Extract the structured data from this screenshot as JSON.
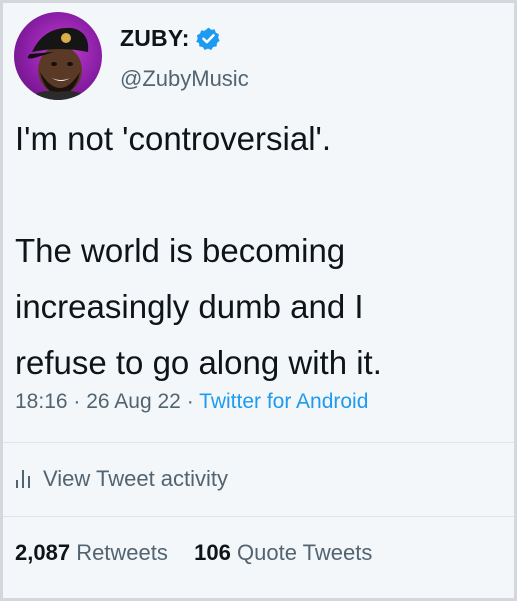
{
  "tweet": {
    "display_name": "ZUBY:",
    "handle": "@ZubyMusic",
    "text_lines": [
      "I'm not 'controversial'.",
      "",
      "The world is becoming",
      "increasingly dumb and I",
      "refuse to go along with it."
    ],
    "time": "18:16",
    "date": "26 Aug 22",
    "source": "Twitter for Android",
    "separator": "·"
  },
  "activity": {
    "label": "View Tweet activity",
    "icon": "bar-chart-icon"
  },
  "stats": {
    "retweets_count": "2,087",
    "retweets_label": "Retweets",
    "quotes_count": "106",
    "quotes_label": "Quote Tweets"
  },
  "colors": {
    "background": "#f3f7fa",
    "text": "#0f1419",
    "secondary": "#536471",
    "accent": "#1d9bf0",
    "avatar_ring": "#8a1ea6"
  }
}
